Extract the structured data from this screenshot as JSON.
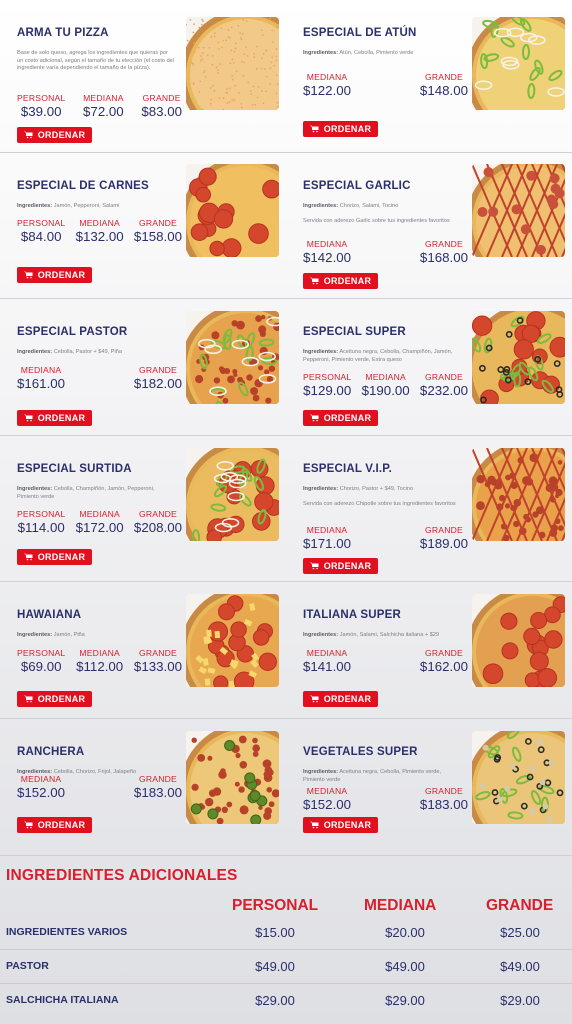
{
  "labels": {
    "personal": "PERSONAL",
    "mediana": "MEDIANA",
    "grande": "GRANDE",
    "order_button": "ORDENAR",
    "ingredients_prefix": "Ingredientes:"
  },
  "icons": {
    "order": "cart-icon"
  },
  "colors": {
    "accent_red": "#e0101e",
    "navy": "#2b2f6b",
    "label_red": "#d6202d"
  },
  "pizzas": [
    {
      "name": "ARMA TU PIZZA",
      "description": "Base de solo queso, agrega los ingredientes que quieras por un costo adicional, según el tamaño de tu elección (el costo del ingrediente varía dependiendo el tamaño de la pizza).",
      "prices": [
        {
          "size": "PERSONAL",
          "price": "$39.00"
        },
        {
          "size": "MEDIANA",
          "price": "$72.00"
        },
        {
          "size": "GRANDE",
          "price": "$83.00"
        }
      ]
    },
    {
      "name": "ESPECIAL DE ATÚN",
      "ingredients": "Atún, Cebolla, Pimiento verde",
      "prices": [
        {
          "size": "MEDIANA",
          "price": "$122.00"
        },
        {
          "size": "GRANDE",
          "price": "$148.00"
        }
      ]
    },
    {
      "name": "ESPECIAL DE CARNES",
      "ingredients": "Jamón, Pepperoni, Salami",
      "prices": [
        {
          "size": "PERSONAL",
          "price": "$84.00"
        },
        {
          "size": "MEDIANA",
          "price": "$132.00"
        },
        {
          "size": "GRANDE",
          "price": "$158.00"
        }
      ]
    },
    {
      "name": "ESPECIAL GARLIC",
      "ingredients": "Chorizo, Salami, Tocino",
      "note": "Servida con aderezo Garlic sobre tus ingredientes favoritos",
      "prices": [
        {
          "size": "MEDIANA",
          "price": "$142.00"
        },
        {
          "size": "GRANDE",
          "price": "$168.00"
        }
      ]
    },
    {
      "name": "ESPECIAL PASTOR",
      "ingredients": "Cebolla, Pastor + $49, Piña",
      "prices": [
        {
          "size": "MEDIANA",
          "price": "$161.00"
        },
        {
          "size": "GRANDE",
          "price": "$182.00"
        }
      ]
    },
    {
      "name": "ESPECIAL SUPER",
      "ingredients": "Aceituna negra, Cebolla, Champiñón, Jamón, Pepperoni, Pimiento verde, Extra queso",
      "prices": [
        {
          "size": "PERSONAL",
          "price": "$129.00"
        },
        {
          "size": "MEDIANA",
          "price": "$190.00"
        },
        {
          "size": "GRANDE",
          "price": "$232.00"
        }
      ]
    },
    {
      "name": "ESPECIAL SURTIDA",
      "ingredients": "Cebolla, Champiñón, Jamón, Pepperoni, Pimiento verde",
      "prices": [
        {
          "size": "PERSONAL",
          "price": "$114.00"
        },
        {
          "size": "MEDIANA",
          "price": "$172.00"
        },
        {
          "size": "GRANDE",
          "price": "$208.00"
        }
      ]
    },
    {
      "name": "ESPECIAL V.I.P.",
      "ingredients": "Chorizo, Pastor + $49, Tocino",
      "note": "Servida con aderezo Chipotle sobre tus ingredientes favoritos",
      "prices": [
        {
          "size": "MEDIANA",
          "price": "$171.00"
        },
        {
          "size": "GRANDE",
          "price": "$189.00"
        }
      ]
    },
    {
      "name": "HAWAIANA",
      "ingredients": "Jamón, Piña",
      "prices": [
        {
          "size": "PERSONAL",
          "price": "$69.00"
        },
        {
          "size": "MEDIANA",
          "price": "$112.00"
        },
        {
          "size": "GRANDE",
          "price": "$133.00"
        }
      ]
    },
    {
      "name": "ITALIANA SUPER",
      "ingredients": "Jamón, Salami, Salchicha italiana + $29",
      "prices": [
        {
          "size": "MEDIANA",
          "price": "$141.00"
        },
        {
          "size": "GRANDE",
          "price": "$162.00"
        }
      ]
    },
    {
      "name": "RANCHERA",
      "ingredients": "Cebolla, Chorizo, Frijol, Jalapeño",
      "prices": [
        {
          "size": "MEDIANA",
          "price": "$152.00"
        },
        {
          "size": "GRANDE",
          "price": "$183.00"
        }
      ]
    },
    {
      "name": "VEGETALES SUPER",
      "ingredients": "Aceituna negra, Cebolla, Pimiento verde, Pimiento verde",
      "prices": [
        {
          "size": "MEDIANA",
          "price": "$152.00"
        },
        {
          "size": "GRANDE",
          "price": "$183.00"
        }
      ]
    }
  ],
  "extras": {
    "title": "INGREDIENTES ADICIONALES",
    "headers": [
      "PERSONAL",
      "MEDIANA",
      "GRANDE"
    ],
    "rows": [
      {
        "name": "INGREDIENTES VARIOS",
        "values": [
          "$15.00",
          "$20.00",
          "$25.00"
        ]
      },
      {
        "name": "PASTOR",
        "values": [
          "$49.00",
          "$49.00",
          "$49.00"
        ]
      },
      {
        "name": "SALCHICHA ITALIANA",
        "values": [
          "$29.00",
          "$29.00",
          "$29.00"
        ]
      }
    ]
  }
}
